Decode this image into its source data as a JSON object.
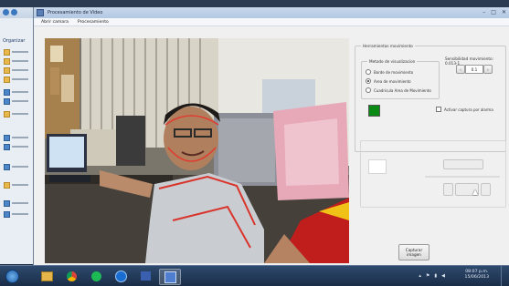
{
  "window": {
    "title": "Procesamiento de Video",
    "controls": {
      "minimize": "–",
      "maximize": "□",
      "close": "✕"
    }
  },
  "menu": [
    "Abrir camara",
    "Procesamiento"
  ],
  "explorer": {
    "organize_label": "Organizar"
  },
  "panel": {
    "group_title": "Herramientas movimiento",
    "sensitivity_label": "Sensibilidad movimiento: 0.013-1",
    "sensitivity_value": "0.1",
    "method_title": "Metodo de visualizacion",
    "methods": [
      {
        "label": "Borde de movimiento",
        "selected": false
      },
      {
        "label": "Area de movimiento",
        "selected": true
      },
      {
        "label": "Cuadricula Area de Movimiento",
        "selected": false
      }
    ],
    "auto_capture_label": "Activar captura por alarma",
    "indicator_color": "#0a8a14",
    "capture_button": "Capturar imagen"
  },
  "taskbar": {
    "time": "08:07 p.m.",
    "date": "15/06/2013",
    "apps": [
      "start-orb",
      "explorer",
      "chrome",
      "spotify",
      "media-center",
      "video-app",
      "processing-app"
    ]
  }
}
